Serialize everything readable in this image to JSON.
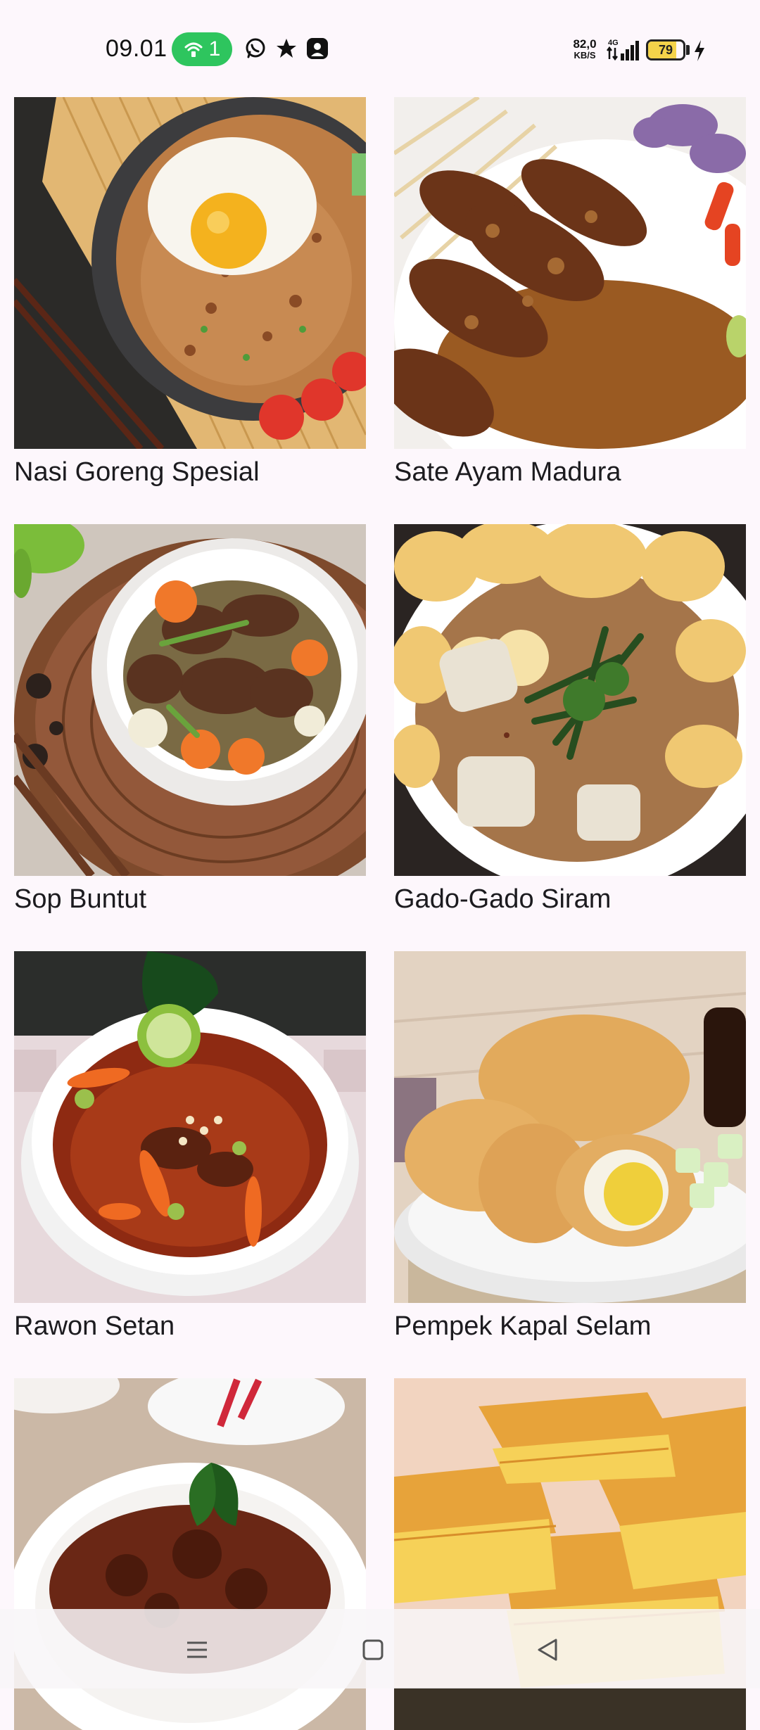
{
  "status_bar": {
    "time": "09.01",
    "hotspot_count": "1",
    "network_speed": "82,0",
    "network_speed_unit": "KB/S",
    "network_type": "4G",
    "battery_level": "79",
    "battery_fraction": 0.79,
    "icons": [
      "wifi-hotspot-icon",
      "whatsapp-icon",
      "star-icon",
      "app-notification-icon",
      "signal-icon",
      "battery-icon",
      "charging-bolt-icon"
    ]
  },
  "foods": [
    {
      "name": "Nasi Goreng Spesial",
      "image": "nasi-goreng-image"
    },
    {
      "name": "Sate Ayam Madura",
      "image": "sate-ayam-image"
    },
    {
      "name": "Sop Buntut",
      "image": "sop-buntut-image"
    },
    {
      "name": "Gado-Gado Siram",
      "image": "gado-gado-image"
    },
    {
      "name": "Rawon Setan",
      "image": "rawon-image"
    },
    {
      "name": "Pempek Kapal Selam",
      "image": "pempek-image"
    },
    {
      "name": "",
      "image": "rendang-image"
    },
    {
      "name": "",
      "image": "martabak-manis-image"
    }
  ],
  "nav_bar": {
    "buttons": [
      "menu-icon",
      "home-icon",
      "back-icon"
    ]
  },
  "colors": {
    "background": "#fdf7fc",
    "text": "#1c1b1f",
    "hotspot": "#2ec55e",
    "battery": "#f4d34a"
  }
}
